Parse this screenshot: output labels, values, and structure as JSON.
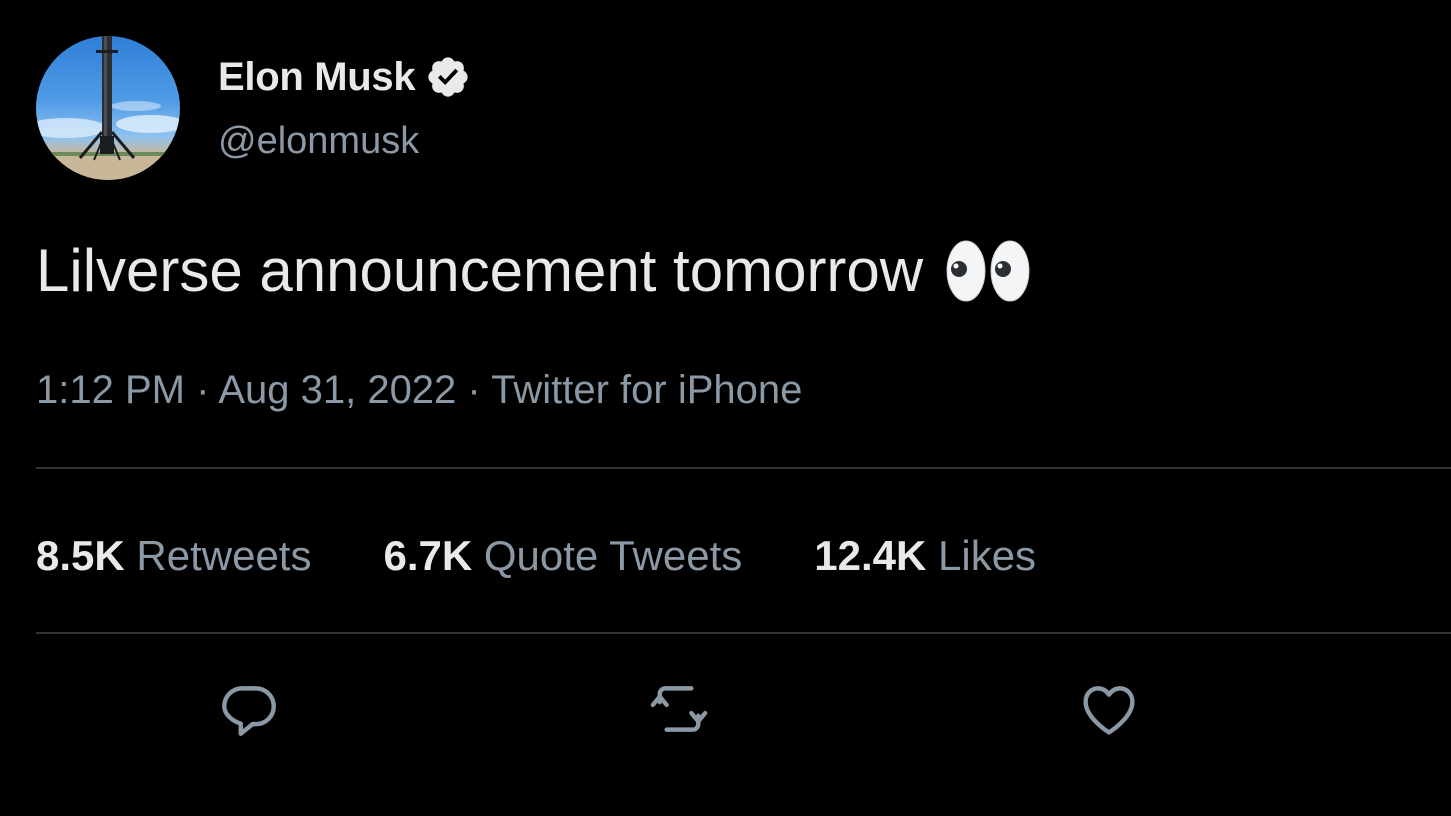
{
  "author": {
    "display_name": "Elon Musk",
    "handle": "@elonmusk",
    "verified": true,
    "avatar_icon": "rocket-booster-photo"
  },
  "tweet": {
    "text": "Lilverse announcement tomorrow",
    "emoji": "👀",
    "time": "1:12 PM",
    "date": "Aug 31, 2022",
    "source": "Twitter for iPhone",
    "separator": " · "
  },
  "stats": {
    "retweets_count": "8.5K",
    "retweets_label": "Retweets",
    "quote_tweets_count": "6.7K",
    "quote_tweets_label": "Quote Tweets",
    "likes_count": "12.4K",
    "likes_label": "Likes"
  },
  "actions": [
    {
      "name": "reply",
      "icon": "reply-icon"
    },
    {
      "name": "retweet",
      "icon": "retweet-icon"
    },
    {
      "name": "like",
      "icon": "heart-icon"
    }
  ],
  "colors": {
    "background": "#000000",
    "primary_text": "#e7e9ea",
    "secondary_text": "#8b98a5",
    "divider": "#2f3336"
  }
}
